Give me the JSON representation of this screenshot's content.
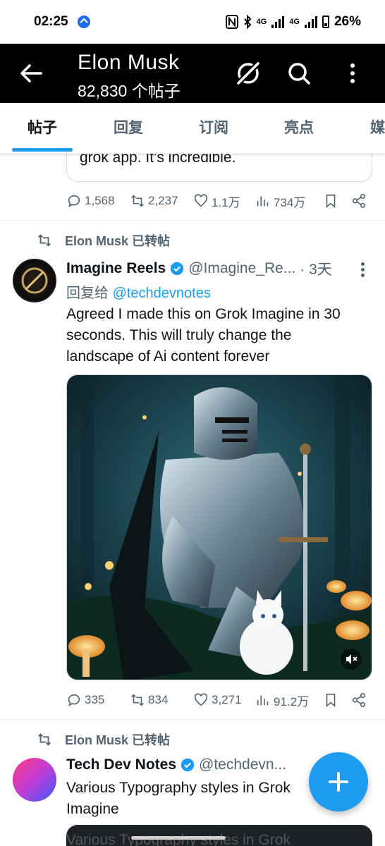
{
  "status_bar": {
    "time": "02:25",
    "network_1": "4G",
    "network_2": "4G",
    "battery": "26%"
  },
  "header": {
    "title": "Elon Musk",
    "subtitle": "82,830 个帖子"
  },
  "tabs": [
    {
      "label": "帖子",
      "active": true
    },
    {
      "label": "回复",
      "active": false
    },
    {
      "label": "订阅",
      "active": false
    },
    {
      "label": "亮点",
      "active": false
    },
    {
      "label": "媒",
      "active": false
    }
  ],
  "prev_post": {
    "quote_tail_text": "grok app. It’s incredible.",
    "stats": {
      "replies": "1,568",
      "reposts": "2,237",
      "likes": "1.1万",
      "views": "734万"
    }
  },
  "post1": {
    "repost_by": "Elon Musk 已转帖",
    "name": "Imagine Reels",
    "handle": "@Imagine_Re...",
    "time": "· 3天",
    "reply_prefix": "回复给",
    "reply_to": "@techdevnotes",
    "text_lines": [
      "Agreed I made this on Grok Imagine in 30",
      "seconds. This will truly change the",
      "landscape of Ai content forever"
    ],
    "stats": {
      "replies": "335",
      "reposts": "834",
      "likes": "3,271",
      "views": "91.2万"
    }
  },
  "post2": {
    "repost_by": "Elon Musk 已转帖",
    "name": "Tech Dev Notes",
    "handle": "@techdevn...",
    "text_lines": [
      "Various Typography styles in Grok",
      "Imagine"
    ],
    "media_peek_text": "Various Typography styles in Grok"
  },
  "colors": {
    "accent": "#1d9bf0",
    "header_bg": "#000000",
    "secondary_text": "#536471"
  }
}
